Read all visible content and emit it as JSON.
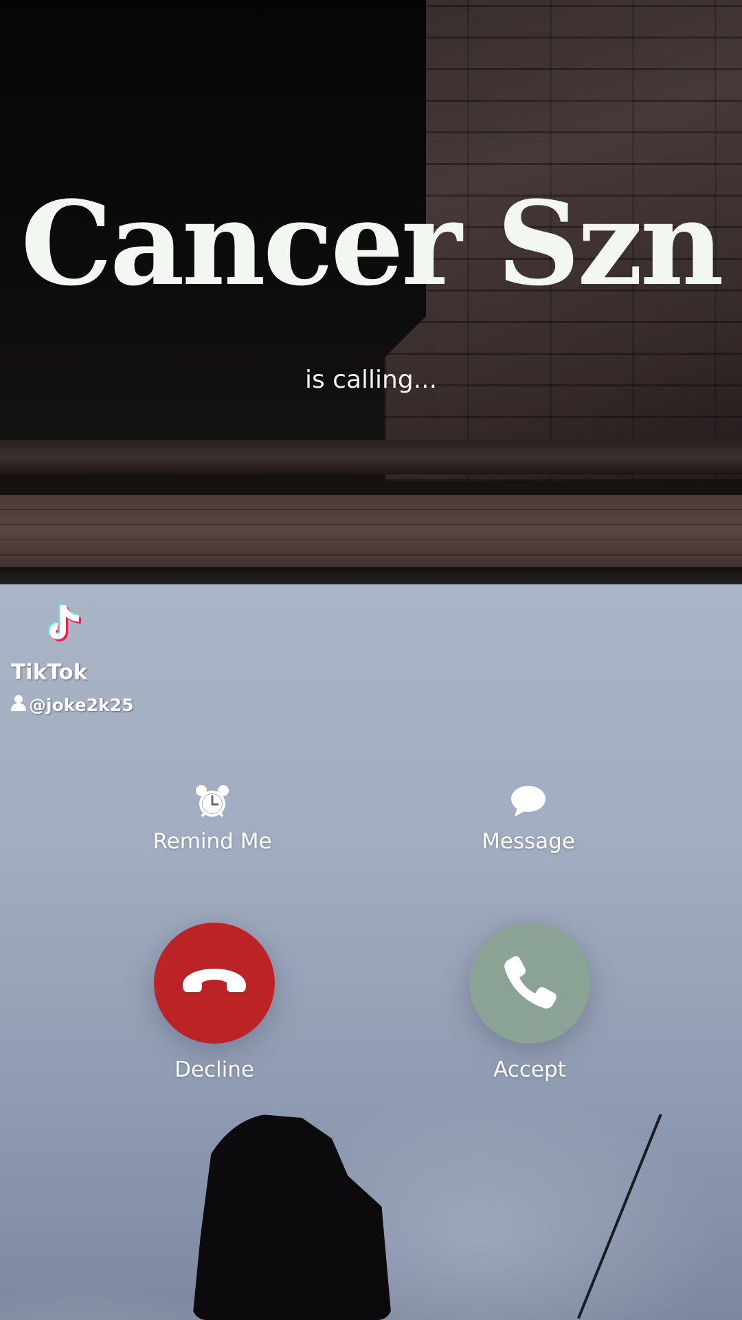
{
  "call": {
    "caller_name": "Cancer Szn",
    "status": "is calling..."
  },
  "watermark": {
    "brand": "TikTok",
    "handle": "@joke2k25",
    "logo_icon": "tiktok-note-icon",
    "user_icon": "person-icon"
  },
  "actions": {
    "remind": {
      "label": "Remind Me",
      "icon": "alarm-clock-icon"
    },
    "message": {
      "label": "Message",
      "icon": "speech-bubble-icon"
    },
    "decline": {
      "label": "Decline",
      "icon": "phone-hangup-icon",
      "color": "#bb2327"
    },
    "accept": {
      "label": "Accept",
      "icon": "phone-icon",
      "color": "#8ba394"
    }
  }
}
